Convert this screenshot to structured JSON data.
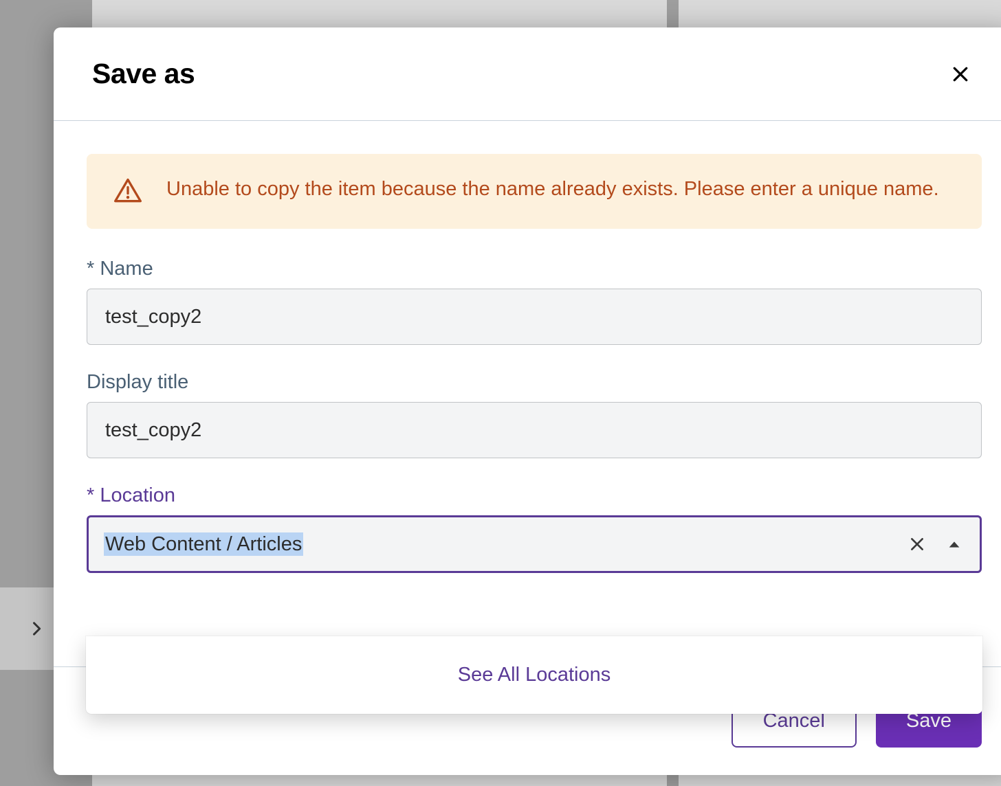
{
  "modal": {
    "title": "Save as",
    "alert": {
      "message": "Unable to copy the item because the name already exists. Please enter a unique name."
    },
    "fields": {
      "name": {
        "label": "Name",
        "required_prefix": "* ",
        "value": "test_copy2"
      },
      "display_title": {
        "label": "Display title",
        "value": "test_copy2"
      },
      "location": {
        "label": "Location",
        "required_prefix": "* ",
        "value": "Web Content / Articles"
      }
    },
    "dropdown": {
      "see_all": "See All Locations"
    },
    "footer": {
      "cancel": "Cancel",
      "save": "Save"
    }
  }
}
